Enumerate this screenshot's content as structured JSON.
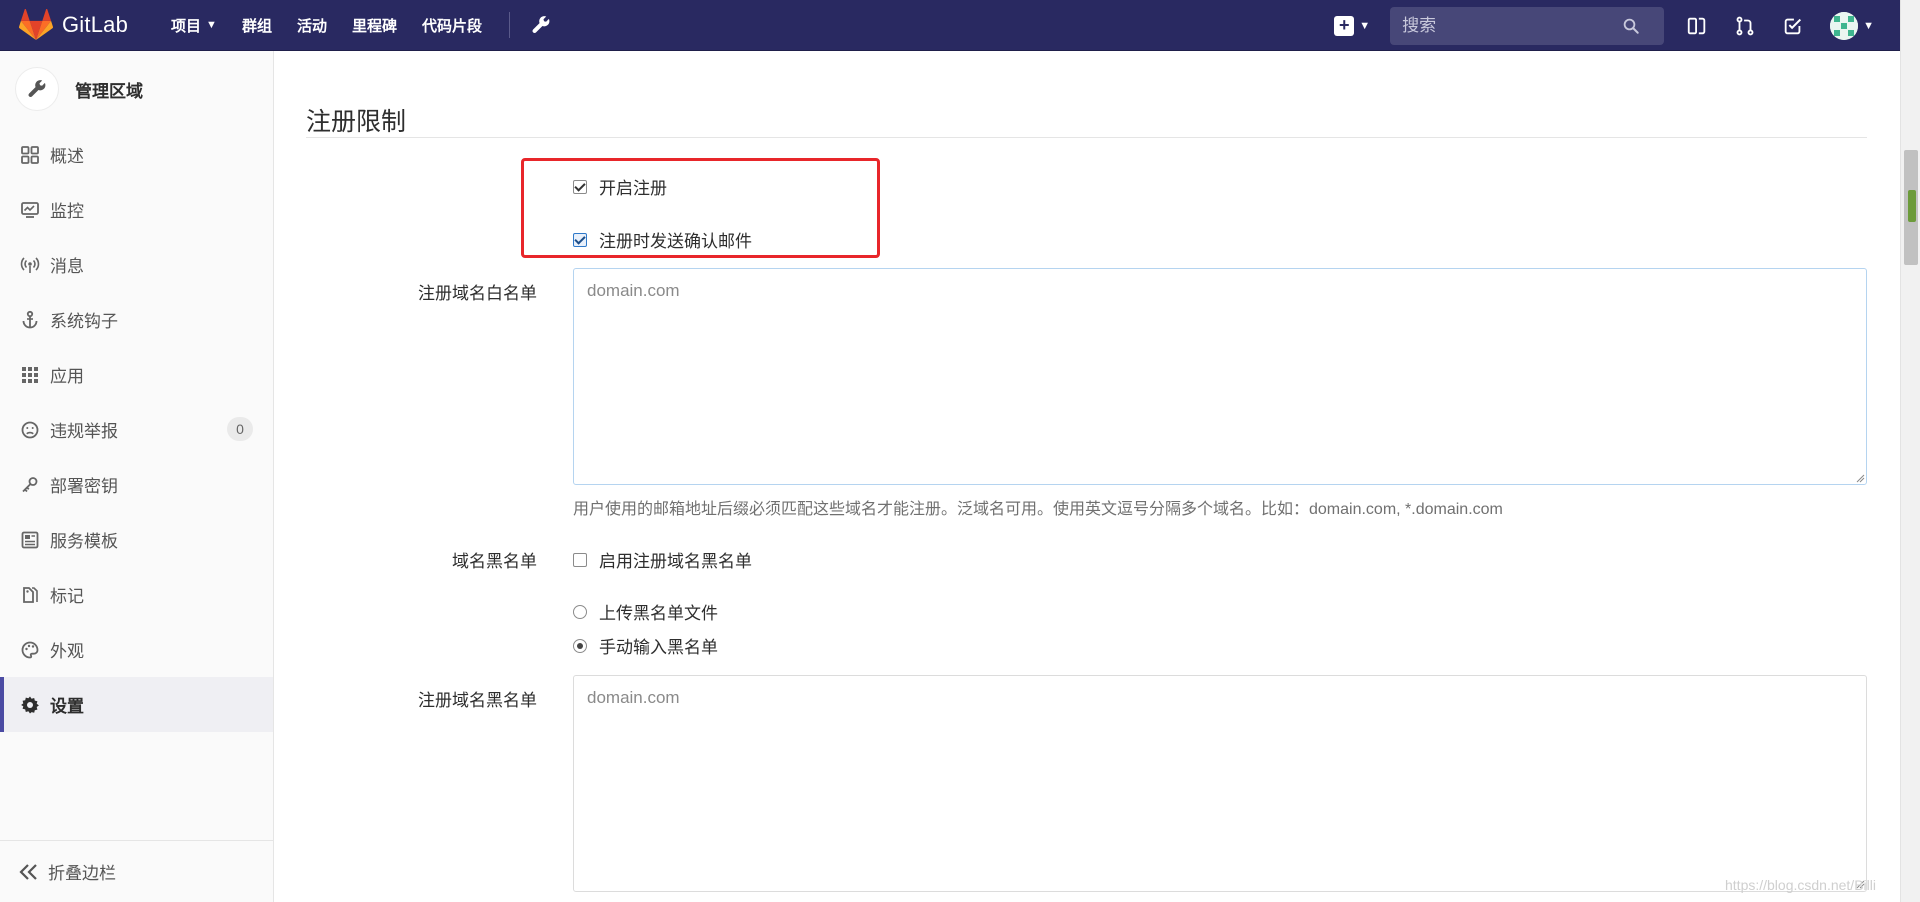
{
  "app": {
    "name": "GitLab"
  },
  "navbar": {
    "links": [
      "项目",
      "群组",
      "活动",
      "里程碑",
      "代码片段"
    ],
    "search_placeholder": "搜索"
  },
  "sidebar": {
    "title": "管理区域",
    "items": [
      {
        "label": "概述",
        "icon": "overview-icon"
      },
      {
        "label": "监控",
        "icon": "monitor-icon"
      },
      {
        "label": "消息",
        "icon": "broadcast-icon"
      },
      {
        "label": "系统钩子",
        "icon": "hook-icon"
      },
      {
        "label": "应用",
        "icon": "apps-icon"
      },
      {
        "label": "违规举报",
        "icon": "abuse-icon",
        "badge": "0"
      },
      {
        "label": "部署密钥",
        "icon": "key-icon"
      },
      {
        "label": "服务模板",
        "icon": "template-icon"
      },
      {
        "label": "标记",
        "icon": "label-icon"
      },
      {
        "label": "外观",
        "icon": "palette-icon"
      },
      {
        "label": "设置",
        "icon": "settings-icon",
        "active": true
      }
    ],
    "collapse_label": "折叠边栏"
  },
  "main": {
    "section_title": "注册限制",
    "signup_enabled": {
      "label": "开启注册",
      "checked": true
    },
    "send_confirmation": {
      "label": "注册时发送确认邮件",
      "checked": true
    },
    "whitelist": {
      "label": "注册域名白名单",
      "placeholder": "domain.com"
    },
    "whitelist_help": "用户使用的邮箱地址后缀必须匹配这些域名才能注册。泛域名可用。使用英文逗号分隔多个域名。比如：domain.com, *.domain.com",
    "blacklist_enable": {
      "row_label": "域名黑名单",
      "label": "启用注册域名黑名单",
      "checked": false
    },
    "blacklist_upload": {
      "label": "上传黑名单文件",
      "checked": false
    },
    "blacklist_manual": {
      "label": "手动输入黑名单",
      "checked": true
    },
    "blacklist": {
      "label": "注册域名黑名单",
      "placeholder": "domain.com"
    }
  },
  "watermark": "https://blog.csdn.net/Billi"
}
